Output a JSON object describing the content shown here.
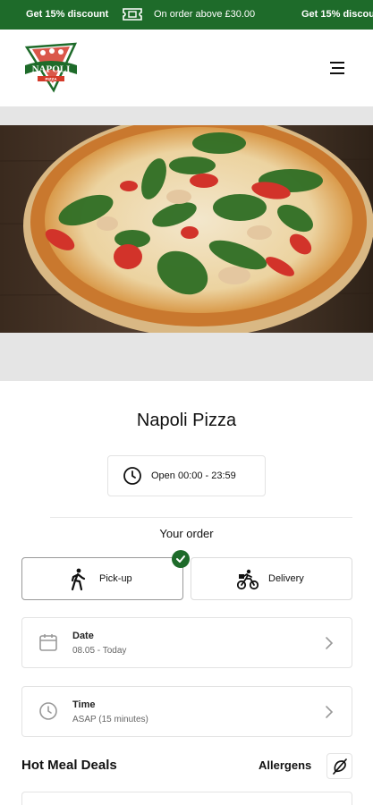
{
  "promo": {
    "discount_text": "Get 15% discount",
    "condition_text": "On order above £30.00",
    "discount_text_repeat": "Get 15% discou"
  },
  "header": {
    "logo_text": "NAPOLI",
    "logo_subtext": "PIZZA",
    "menu_icon": "hamburger-menu-icon"
  },
  "restaurant": {
    "name": "Napoli Pizza",
    "hours": "Open 00:00 - 23:59"
  },
  "order": {
    "heading": "Your order",
    "options": [
      {
        "label": "Pick-up",
        "icon": "walking-person-icon",
        "selected": true
      },
      {
        "label": "Delivery",
        "icon": "cyclist-icon",
        "selected": false
      }
    ],
    "date": {
      "label": "Date",
      "value": "08.05 - Today",
      "icon": "calendar-icon"
    },
    "time": {
      "label": "Time",
      "value": "ASAP (15 minutes)",
      "icon": "clock-icon"
    }
  },
  "menu": {
    "section_title": "Hot Meal Deals",
    "allergens_label": "Allergens",
    "allergens_icon": "allergen-filter-icon"
  },
  "colors": {
    "brand_green": "#1e6b2a",
    "border": "#e3e3e3"
  }
}
